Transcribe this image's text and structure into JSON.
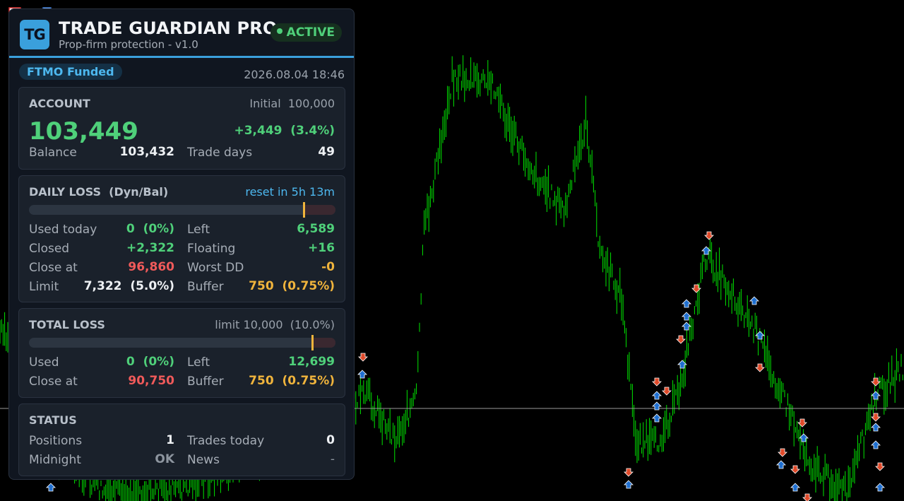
{
  "header": {
    "logo_text": "TG",
    "title": "TRADE GUARDIAN PRO",
    "subtitle": "Prop-firm protection  -  v1.0",
    "status": "ACTIVE",
    "status_color": "#4fd07a",
    "accent": "#3aa0dc"
  },
  "prop_badge": "FTMO Funded",
  "datetime": "2026.08.04 18:46",
  "account": {
    "title": "ACCOUNT",
    "initial_label": "Initial",
    "initial_value": "100,000",
    "equity": "103,449",
    "change": "+3,449  (3.4%)",
    "balance_label": "Balance",
    "balance_value": "103,432",
    "trade_days_label": "Trade days",
    "trade_days_value": "49"
  },
  "daily_loss": {
    "title": "DAILY LOSS  (Dyn/Bal)",
    "reset": "reset in 5h 13m",
    "progress_fraction": 0.0,
    "used_today_label": "Used today",
    "used_today_value": "0  (0%)",
    "left_label": "Left",
    "left_value": "6,589",
    "closed_label": "Closed",
    "closed_value": "+2,322",
    "floating_label": "Floating",
    "floating_value": "+16",
    "close_at_label": "Close at",
    "close_at_value": "96,860",
    "worst_dd_label": "Worst DD",
    "worst_dd_value": "-0",
    "limit_label": "Limit",
    "limit_value": "7,322  (5.0%)",
    "buffer_label": "Buffer",
    "buffer_value": "750  (0.75%)"
  },
  "total_loss": {
    "title": "TOTAL LOSS",
    "limit": "limit 10,000  (10.0%)",
    "progress_fraction": 0.0,
    "used_label": "Used",
    "used_value": "0  (0%)",
    "left_label": "Left",
    "left_value": "12,699",
    "close_at_label": "Close at",
    "close_at_value": "90,750",
    "buffer_label": "Buffer",
    "buffer_value": "750  (0.75%)"
  },
  "status": {
    "title": "STATUS",
    "positions_label": "Positions",
    "positions_value": "1",
    "trades_today_label": "Trades today",
    "trades_today_value": "0",
    "midnight_label": "Midnight",
    "midnight_value": "OK",
    "news_label": "News",
    "news_value": "-"
  },
  "chart": {
    "candle_color": "#00e600",
    "background": "#000000",
    "buy_arrow_color": "#1f6fd0",
    "sell_arrow_color": "#e04a2a",
    "price_line_color": "#9a9a9a"
  }
}
